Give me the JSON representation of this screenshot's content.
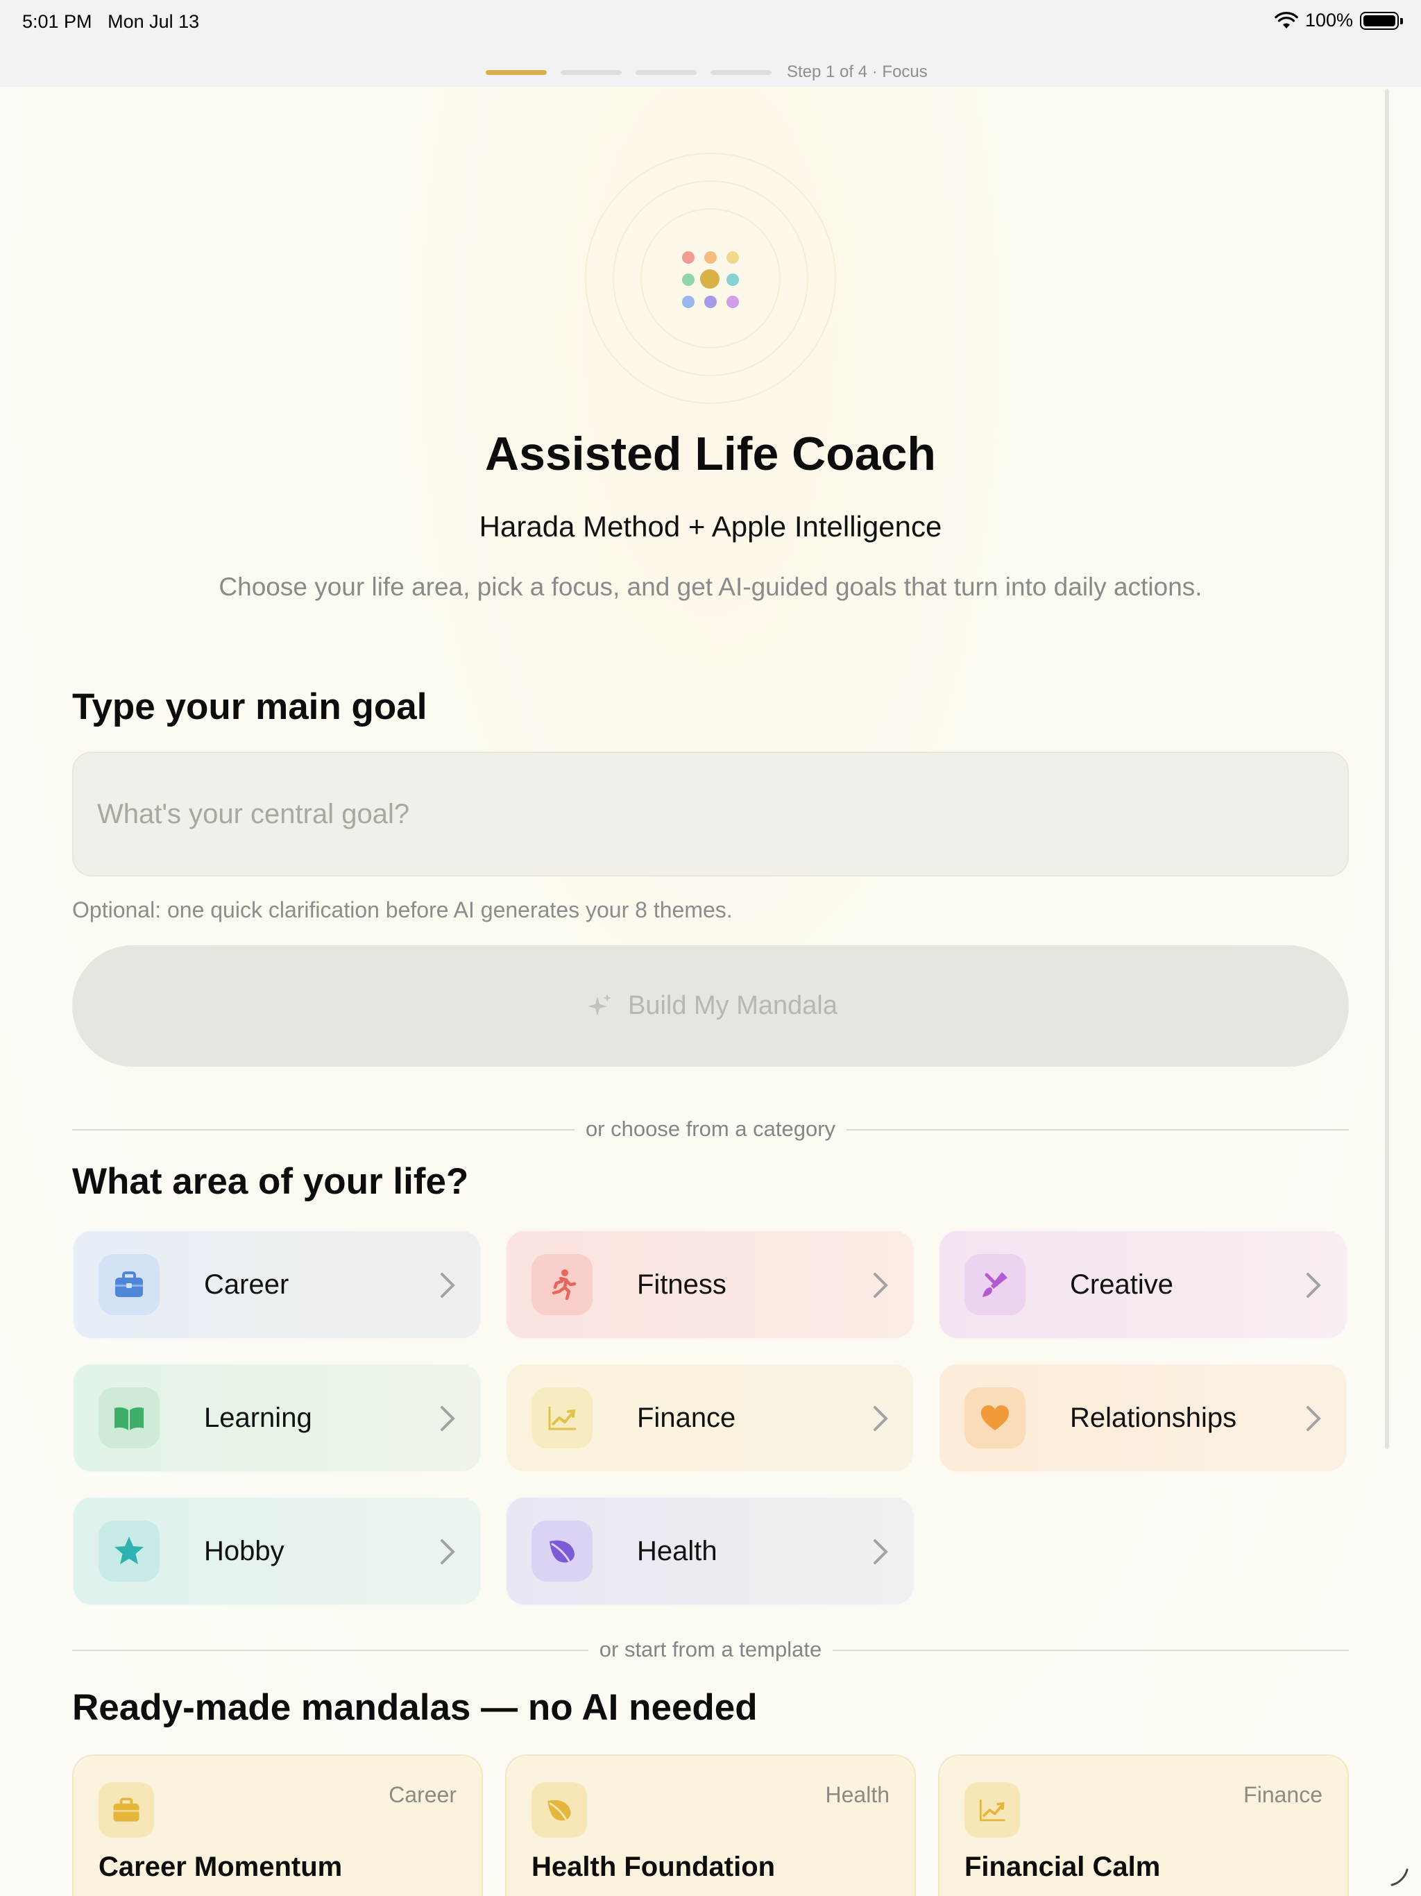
{
  "status_bar": {
    "time": "5:01 PM",
    "date": "Mon Jul 13",
    "battery": "100%"
  },
  "progress": {
    "label": "Step 1 of 4 · Focus",
    "current_step": 1,
    "total_steps": 4
  },
  "hero": {
    "title": "Assisted Life Coach",
    "subtitle": "Harada Method + Apple Intelligence",
    "description": "Choose your life area, pick a focus, and get AI-guided goals that turn into daily actions."
  },
  "goal": {
    "heading": "Type your main goal",
    "placeholder": "What's your central goal?",
    "value": "",
    "hint": "Optional: one quick clarification before AI generates your 8 themes.",
    "build_button": "Build My Mandala"
  },
  "category_divider": "or choose from a category",
  "categories": {
    "heading": "What area of your life?",
    "items": [
      {
        "label": "Career",
        "icon": "briefcase-icon",
        "color": "#4f86d6"
      },
      {
        "label": "Fitness",
        "icon": "running-figure-icon",
        "color": "#e9645a"
      },
      {
        "label": "Creative",
        "icon": "paintbrush-icon",
        "color": "#b45bd0"
      },
      {
        "label": "Learning",
        "icon": "open-book-icon",
        "color": "#3fae6a"
      },
      {
        "label": "Finance",
        "icon": "chart-up-icon",
        "color": "#e1c24c"
      },
      {
        "label": "Relationships",
        "icon": "heart-icon",
        "color": "#f09a3a"
      },
      {
        "label": "Hobby",
        "icon": "star-icon",
        "color": "#2fb3b0"
      },
      {
        "label": "Health",
        "icon": "leaf-icon",
        "color": "#7b5cd6"
      }
    ]
  },
  "template_divider": "or start from a template",
  "templates": {
    "heading": "Ready-made mandalas — no AI needed",
    "items": [
      {
        "name": "Career Momentum",
        "category": "Career",
        "icon": "briefcase-icon"
      },
      {
        "name": "Health Foundation",
        "category": "Health",
        "icon": "leaf-icon"
      },
      {
        "name": "Financial Calm",
        "category": "Finance",
        "icon": "chart-up-icon"
      }
    ]
  },
  "colors": {
    "accent": "#d9b247",
    "background": "#fdfbf3"
  }
}
